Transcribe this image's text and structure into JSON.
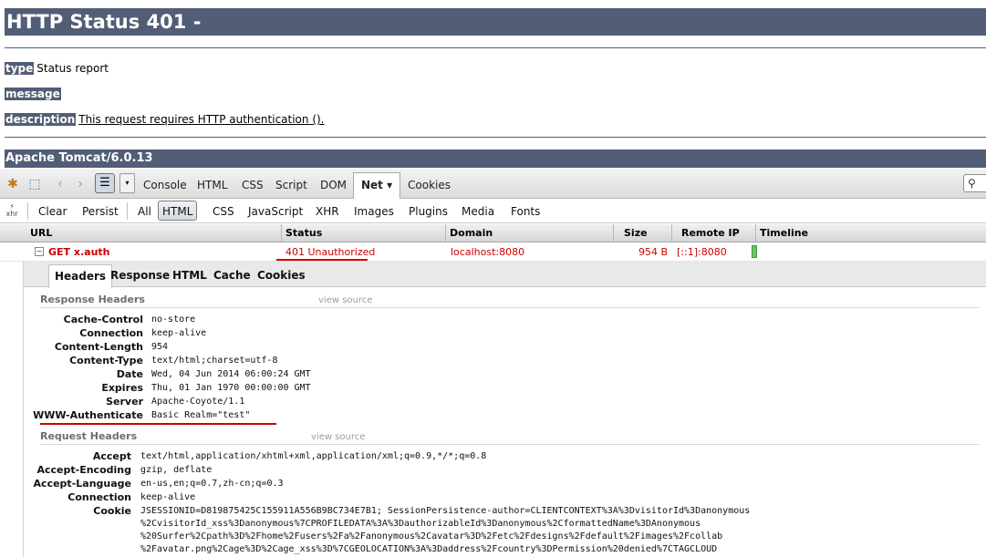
{
  "tomcat": {
    "title": "HTTP Status 401 -",
    "type_label": "type",
    "type_value": "Status report",
    "message_label": "message",
    "description_label": "description",
    "description_value": "This request requires HTTP authentication ().",
    "footer": "Apache Tomcat/6.0.13"
  },
  "firebug": {
    "toolbar": {
      "tabs": [
        "Console",
        "HTML",
        "CSS",
        "Script",
        "DOM",
        "Net",
        "Cookies"
      ],
      "active_tab": "Net",
      "active_tab_arrow": "▾",
      "list_glyph": "☰",
      "dropdown_glyph": "▾",
      "search_glyph": "⚲"
    },
    "filter": {
      "xhr_label": "xhr",
      "buttons": [
        "Clear",
        "Persist",
        "All",
        "HTML",
        "CSS",
        "JavaScript",
        "XHR",
        "Images",
        "Plugins",
        "Media",
        "Fonts"
      ],
      "active": "HTML"
    },
    "net": {
      "columns": [
        "URL",
        "Status",
        "Domain",
        "Size",
        "Remote IP",
        "Timeline"
      ],
      "request": {
        "toggle": "−",
        "url": "GET x.auth",
        "status": "401 Unauthorized",
        "domain": "localhost:8080",
        "size": "954 B",
        "remote_ip": "[::1]:8080"
      }
    },
    "detail": {
      "tabs": [
        "Headers",
        "Response",
        "HTML",
        "Cache",
        "Cookies"
      ],
      "active_tab": "Headers",
      "view_source": "view source",
      "response_headers": {
        "title": "Response Headers",
        "rows": [
          {
            "name": "Cache-Control",
            "value": "no-store"
          },
          {
            "name": "Connection",
            "value": "keep-alive"
          },
          {
            "name": "Content-Length",
            "value": "954"
          },
          {
            "name": "Content-Type",
            "value": "text/html;charset=utf-8"
          },
          {
            "name": "Date",
            "value": "Wed, 04 Jun 2014 06:00:24 GMT"
          },
          {
            "name": "Expires",
            "value": "Thu, 01 Jan 1970 00:00:00 GMT"
          },
          {
            "name": "Server",
            "value": "Apache-Coyote/1.1"
          },
          {
            "name": "WWW-Authenticate",
            "value": "Basic Realm=\"test\""
          }
        ]
      },
      "request_headers": {
        "title": "Request Headers",
        "rows": [
          {
            "name": "Accept",
            "value": "text/html,application/xhtml+xml,application/xml;q=0.9,*/*;q=0.8"
          },
          {
            "name": "Accept-Encoding",
            "value": "gzip, deflate"
          },
          {
            "name": "Accept-Language",
            "value": "en-us,en;q=0.7,zh-cn;q=0.3"
          },
          {
            "name": "Connection",
            "value": "keep-alive"
          },
          {
            "name": "Cookie",
            "value": "JSESSIONID=D819875425C155911A556B9BC734E7B1; SessionPersistence-author=CLIENTCONTEXT%3A%3DvisitorId%3Danonymous"
          }
        ],
        "cookie_continuation": [
          "%2CvisitorId_xss%3Danonymous%7CPROFILEDATA%3A%3DauthorizableId%3Danonymous%2CformattedName%3DAnonymous",
          "%20Surfer%2Cpath%3D%2Fhome%2Fusers%2Fa%2Fanonymous%2Cavatar%3D%2Fetc%2Fdesigns%2Fdefault%2Fimages%2Fcollab",
          "%2Favatar.png%2Cage%3D%2Cage_xss%3D%7CGEOLOCATION%3A%3Daddress%2Fcountry%3DPermission%20denied%7CTAGCLOUD"
        ]
      }
    }
  }
}
